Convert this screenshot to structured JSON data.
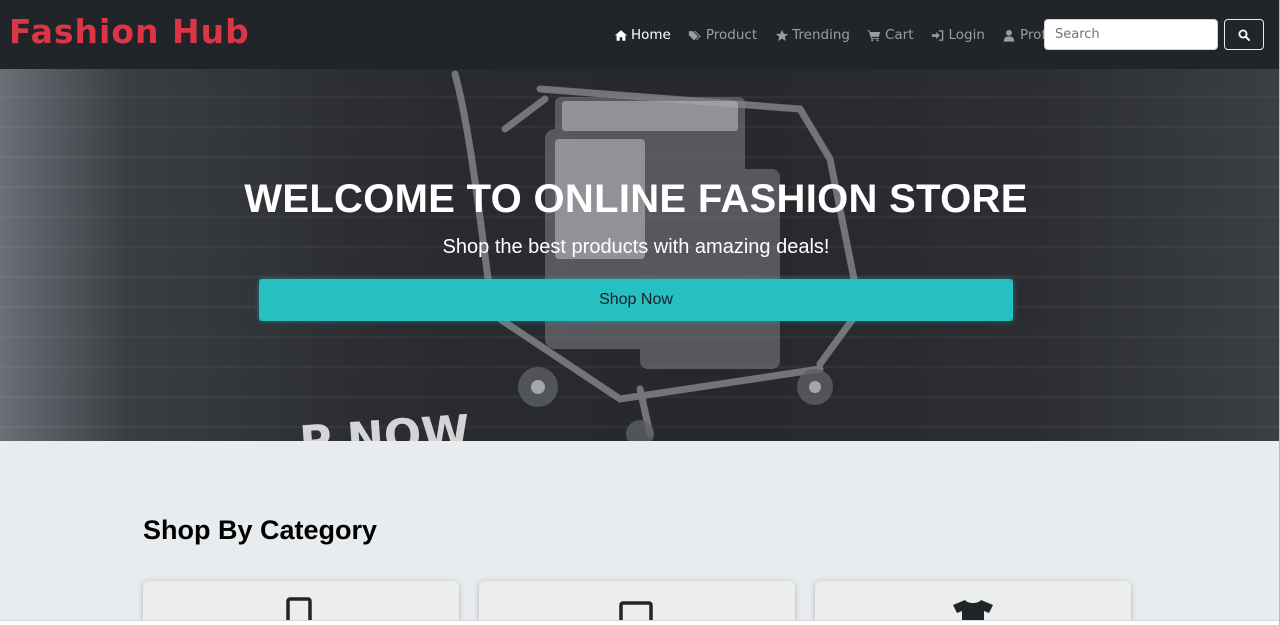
{
  "brand": "Fashion Hub",
  "nav": {
    "items": [
      {
        "label": "Home",
        "icon": "home-icon",
        "active": true
      },
      {
        "label": "Product",
        "icon": "tags-icon",
        "active": false
      },
      {
        "label": "Trending",
        "icon": "star-icon",
        "active": false
      },
      {
        "label": "Cart",
        "icon": "cart-icon",
        "active": false
      },
      {
        "label": "Login",
        "icon": "login-icon",
        "active": false
      },
      {
        "label": "Profile",
        "icon": "user-icon",
        "active": false
      }
    ],
    "search_placeholder": "Search",
    "search_button_icon": "search-icon"
  },
  "hero": {
    "title": "WELCOME TO ONLINE FASHION STORE",
    "subtitle": "Shop the best products with amazing deals!",
    "button_label": "Shop Now"
  },
  "categories": {
    "title": "Shop By Category",
    "cards": [
      {
        "icon": "mobile-icon"
      },
      {
        "icon": "laptop-icon"
      },
      {
        "icon": "tshirt-icon"
      }
    ]
  },
  "colors": {
    "navbar": "#212529",
    "brand": "#dc3545",
    "button": "#26bfc2",
    "page_background": "#e9ecef"
  }
}
